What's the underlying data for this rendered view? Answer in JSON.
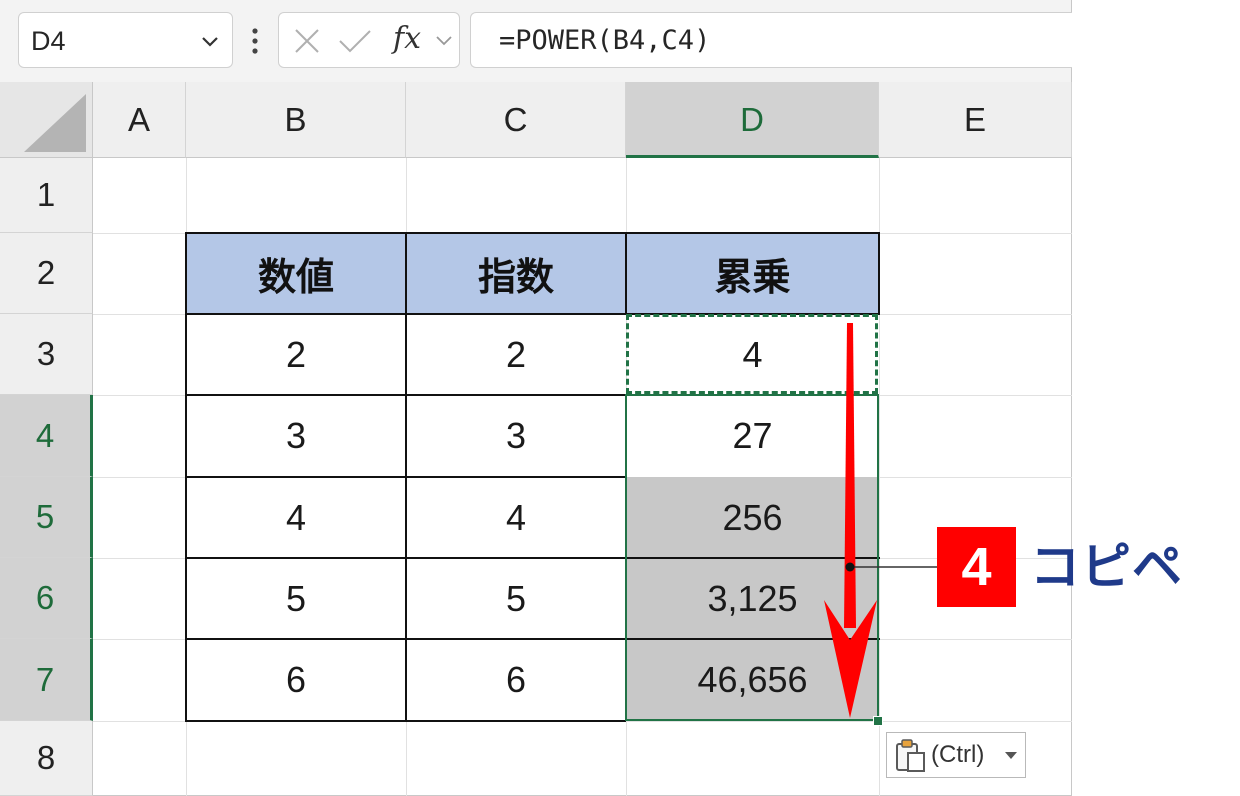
{
  "formula_bar": {
    "name_box": "D4",
    "fx_label": "fx",
    "formula": "=POWER(B4,C4)"
  },
  "columns": [
    "A",
    "B",
    "C",
    "D",
    "E"
  ],
  "selected_column": "D",
  "rows": [
    "1",
    "2",
    "3",
    "4",
    "5",
    "6",
    "7",
    "8"
  ],
  "selected_rows": [
    "4",
    "5",
    "6",
    "7"
  ],
  "table": {
    "headers": [
      "数値",
      "指数",
      "累乗"
    ],
    "rows": [
      [
        "2",
        "2",
        "4"
      ],
      [
        "3",
        "3",
        "27"
      ],
      [
        "4",
        "4",
        "256"
      ],
      [
        "5",
        "5",
        "3,125"
      ],
      [
        "6",
        "6",
        "46,656"
      ]
    ]
  },
  "paste_options": {
    "label": "(Ctrl)"
  },
  "annotation": {
    "step_number": "4",
    "step_text": "コピペ"
  },
  "colors": {
    "selection_green": "#217346",
    "table_header_fill": "#b4c7e7",
    "arrow_red": "#ff0000",
    "annotation_text": "#1f3a8a"
  }
}
